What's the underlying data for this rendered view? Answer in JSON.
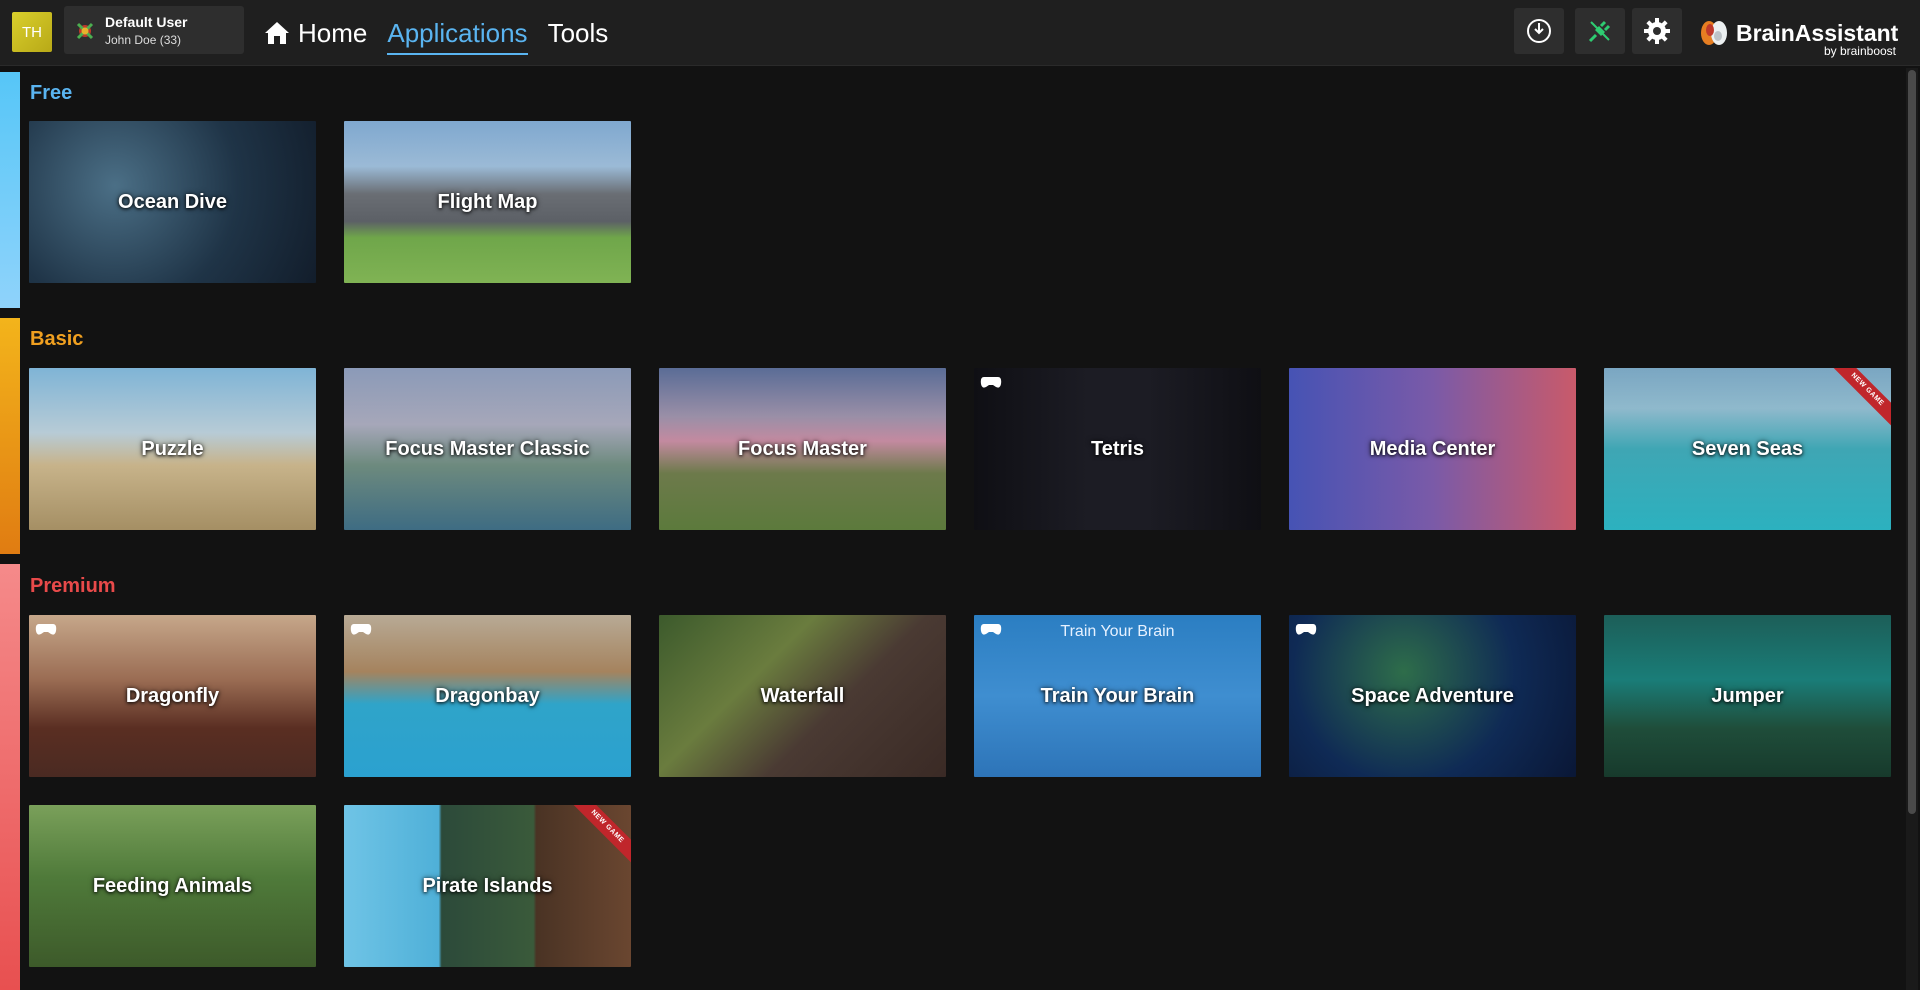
{
  "header": {
    "initials": "TH",
    "user": {
      "name": "Default User",
      "sub": "John Doe (33)"
    },
    "nav": [
      {
        "label": "Home",
        "active": false
      },
      {
        "label": "Applications",
        "active": true
      },
      {
        "label": "Tools",
        "active": false
      }
    ],
    "icons": [
      "power-icon",
      "plug-icon",
      "gear-icon"
    ],
    "brand": {
      "name": "BrainAssistant",
      "sub": "by brainboost"
    }
  },
  "sections": {
    "free": {
      "title": "Free",
      "color": "#5ab4f0"
    },
    "basic": {
      "title": "Basic",
      "color": "#f0a020"
    },
    "premium": {
      "title": "Premium",
      "color": "#e84a4a"
    }
  },
  "apps": {
    "ocean_dive": {
      "title": "Ocean Dive"
    },
    "flight_map": {
      "title": "Flight Map"
    },
    "puzzle": {
      "title": "Puzzle"
    },
    "focus_master_classic": {
      "title": "Focus Master Classic"
    },
    "focus_master": {
      "title": "Focus Master"
    },
    "tetris": {
      "title": "Tetris"
    },
    "media_center": {
      "title": "Media Center"
    },
    "seven_seas": {
      "title": "Seven Seas",
      "badge": "NEW GAME"
    },
    "dragonfly": {
      "title": "Dragonfly"
    },
    "dragonbay": {
      "title": "Dragonbay"
    },
    "waterfall": {
      "title": "Waterfall"
    },
    "train_your_brain": {
      "title": "Train Your Brain",
      "inner": "Train Your Brain"
    },
    "space_adventure": {
      "title": "Space Adventure"
    },
    "jumper": {
      "title": "Jumper"
    },
    "feeding_animals": {
      "title": "Feeding Animals"
    },
    "pirate_islands": {
      "title": "Pirate Islands",
      "badge": "NEW GAME"
    }
  }
}
